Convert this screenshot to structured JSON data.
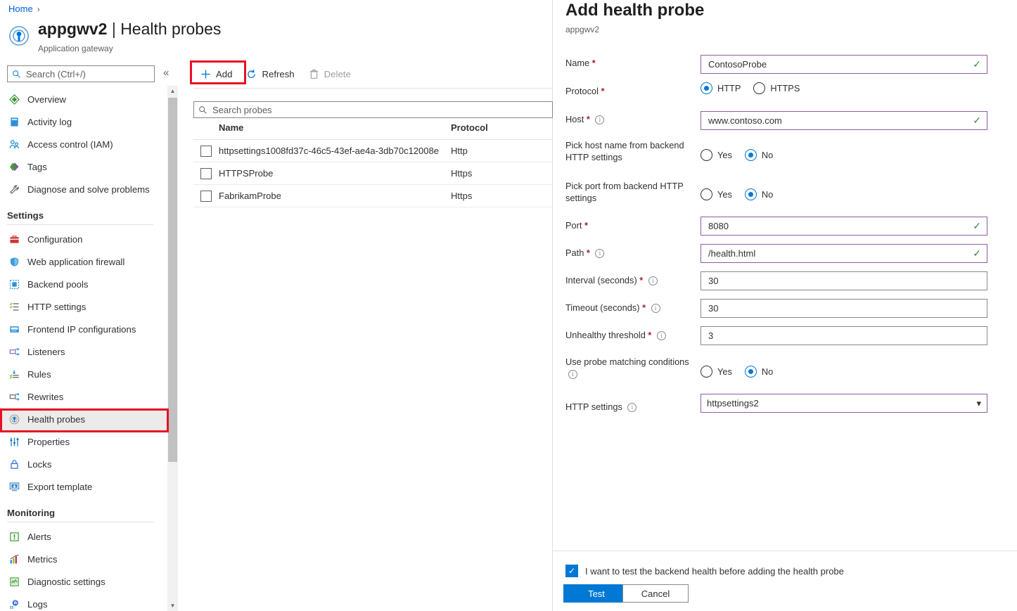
{
  "breadcrumb": {
    "home": "Home",
    "separator": "›"
  },
  "resource": {
    "name": "appgwv2",
    "divider": "|",
    "page": "Health probes",
    "subtitle": "Application gateway",
    "icon": "application-gateway-icon"
  },
  "sidebar": {
    "search_placeholder": "Search (Ctrl+/)",
    "collapse_glyph": "«",
    "items": [
      {
        "label": "Overview",
        "icon": "overview-icon",
        "selected": false,
        "type": "item"
      },
      {
        "label": "Activity log",
        "icon": "activity-log-icon",
        "selected": false,
        "type": "item"
      },
      {
        "label": "Access control (IAM)",
        "icon": "access-control-icon",
        "selected": false,
        "type": "item"
      },
      {
        "label": "Tags",
        "icon": "tags-icon",
        "selected": false,
        "type": "item"
      },
      {
        "label": "Diagnose and solve problems",
        "icon": "wrench-icon",
        "selected": false,
        "type": "item"
      },
      {
        "label": "Settings",
        "type": "group"
      },
      {
        "label": "Configuration",
        "icon": "configuration-icon",
        "selected": false,
        "type": "item"
      },
      {
        "label": "Web application firewall",
        "icon": "shield-icon",
        "selected": false,
        "type": "item"
      },
      {
        "label": "Backend pools",
        "icon": "backend-pools-icon",
        "selected": false,
        "type": "item"
      },
      {
        "label": "HTTP settings",
        "icon": "http-settings-icon",
        "selected": false,
        "type": "item"
      },
      {
        "label": "Frontend IP configurations",
        "icon": "frontend-ip-icon",
        "selected": false,
        "type": "item"
      },
      {
        "label": "Listeners",
        "icon": "listeners-icon",
        "selected": false,
        "type": "item"
      },
      {
        "label": "Rules",
        "icon": "rules-icon",
        "selected": false,
        "type": "item"
      },
      {
        "label": "Rewrites",
        "icon": "rewrites-icon",
        "selected": false,
        "type": "item"
      },
      {
        "label": "Health probes",
        "icon": "health-probe-icon",
        "selected": true,
        "type": "item"
      },
      {
        "label": "Properties",
        "icon": "properties-icon",
        "selected": false,
        "type": "item"
      },
      {
        "label": "Locks",
        "icon": "lock-icon",
        "selected": false,
        "type": "item"
      },
      {
        "label": "Export template",
        "icon": "export-template-icon",
        "selected": false,
        "type": "item"
      },
      {
        "label": "Monitoring",
        "type": "group"
      },
      {
        "label": "Alerts",
        "icon": "alerts-icon",
        "selected": false,
        "type": "item"
      },
      {
        "label": "Metrics",
        "icon": "metrics-icon",
        "selected": false,
        "type": "item"
      },
      {
        "label": "Diagnostic settings",
        "icon": "diagnostic-settings-icon",
        "selected": false,
        "type": "item"
      },
      {
        "label": "Logs",
        "icon": "logs-icon",
        "selected": false,
        "type": "item"
      }
    ]
  },
  "toolbar": {
    "add_label": "Add",
    "refresh_label": "Refresh",
    "delete_label": "Delete"
  },
  "probes_list": {
    "search_placeholder": "Search probes",
    "columns": [
      "Name",
      "Protocol"
    ],
    "rows": [
      {
        "name": "httpsettings1008fd37c-46c5-43ef-ae4a-3db70c12008e",
        "protocol": "Http"
      },
      {
        "name": "HTTPSProbe",
        "protocol": "Https"
      },
      {
        "name": "FabrikamProbe",
        "protocol": "Https"
      }
    ]
  },
  "panel": {
    "title": "Add health probe",
    "subtitle": "appgwv2",
    "fields": {
      "name": {
        "label": "Name",
        "required": true,
        "value": "ContosoProbe",
        "valid": true
      },
      "protocol": {
        "label": "Protocol",
        "required": true,
        "options": [
          "HTTP",
          "HTTPS"
        ],
        "selected": "HTTP"
      },
      "host": {
        "label": "Host",
        "required": true,
        "info": true,
        "value": "www.contoso.com",
        "valid": true
      },
      "pick_host": {
        "label": "Pick host name from backend HTTP settings",
        "options": [
          "Yes",
          "No"
        ],
        "selected": "No"
      },
      "pick_port": {
        "label": "Pick port from backend HTTP settings",
        "options": [
          "Yes",
          "No"
        ],
        "selected": "No"
      },
      "port": {
        "label": "Port",
        "required": true,
        "value": "8080",
        "valid": true
      },
      "path": {
        "label": "Path",
        "required": true,
        "info": true,
        "value": "/health.html",
        "valid": true
      },
      "interval": {
        "label": "Interval (seconds)",
        "required": true,
        "info": true,
        "value": "30",
        "valid": false
      },
      "timeout": {
        "label": "Timeout (seconds)",
        "required": true,
        "info": true,
        "value": "30",
        "valid": false
      },
      "unhealthy_threshold": {
        "label": "Unhealthy threshold",
        "required": true,
        "info": true,
        "value": "3",
        "valid": false
      },
      "probe_matching": {
        "label": "Use probe matching conditions",
        "info": true,
        "options": [
          "Yes",
          "No"
        ],
        "selected": "No"
      },
      "http_settings": {
        "label": "HTTP settings",
        "info": true,
        "value": "httpsettings2",
        "options": [
          "httpsettings2"
        ]
      }
    },
    "footer": {
      "checkbox_label": "I want to test the backend health before adding the health probe",
      "checkbox_checked": true,
      "test_label": "Test",
      "cancel_label": "Cancel"
    }
  },
  "colors": {
    "accent": "#0078d4",
    "highlight_box": "#e81123",
    "valid_check": "#3a8a3a",
    "dirty_border": "#8a5ea8",
    "link": "#015cda",
    "required_star": "#a4262c"
  }
}
